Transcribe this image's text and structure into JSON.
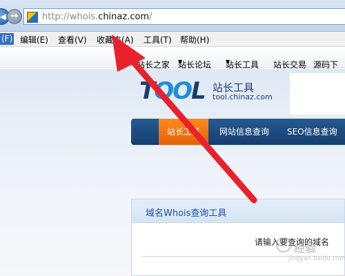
{
  "browser": {
    "url_prefix": "http://whois.",
    "url_domain": "chinaz.com",
    "url_suffix": "/",
    "back_glyph": "◀",
    "forward_glyph": "→"
  },
  "menubar": {
    "items": [
      "(F)",
      "编辑(E)",
      "查看(V)",
      "收藏夹(A)",
      "工具(T)",
      "帮助(H)"
    ]
  },
  "sitenav": {
    "items": [
      "站长之家",
      "站长论坛",
      "站长工具",
      "站长交易",
      "源码下"
    ]
  },
  "logo": {
    "text_t": "T",
    "text_oo": "OO",
    "text_l": "L",
    "cn": "站长工具",
    "url": "tool.chinaz.com"
  },
  "tabs": [
    "站长工具",
    "网站信息查询",
    "SEO信息查询"
  ],
  "panel": {
    "title": "域名Whois查询工具",
    "hint": "请输入要查询的域名"
  },
  "watermark": {
    "text": "经验",
    "sub": "jingyan.baidu.com"
  },
  "colors": {
    "arrow": "#e8212a",
    "tab_active": "#f07a14",
    "tab_bar": "#1d4b80"
  }
}
